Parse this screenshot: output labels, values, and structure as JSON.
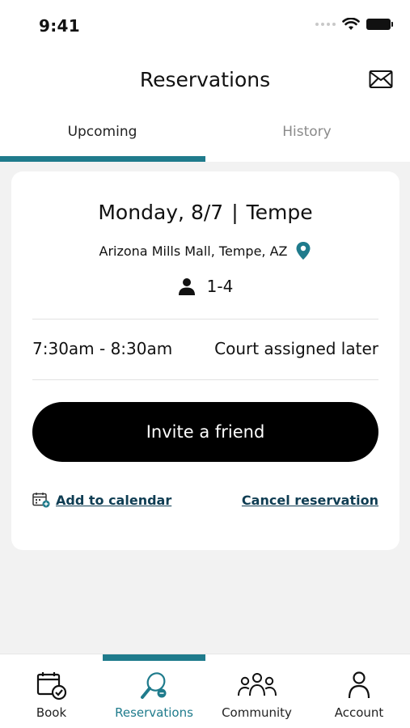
{
  "status_bar": {
    "time": "9:41"
  },
  "header": {
    "title": "Reservations"
  },
  "tabs": [
    {
      "label": "Upcoming",
      "active": true
    },
    {
      "label": "History",
      "active": false
    }
  ],
  "reservation": {
    "date": "Monday, 8/7",
    "separator": "|",
    "city": "Tempe",
    "address": "Arizona Mills Mall, Tempe, AZ",
    "players": "1-4",
    "time": "7:30am - 8:30am",
    "court": "Court assigned later",
    "invite_label": "Invite a friend",
    "add_calendar_label": "Add to calendar",
    "cancel_label": "Cancel reservation"
  },
  "bottom_nav": [
    {
      "label": "Book",
      "icon": "calendar-check-icon",
      "active": false
    },
    {
      "label": "Reservations",
      "icon": "paddle-icon",
      "active": true
    },
    {
      "label": "Community",
      "icon": "group-icon",
      "active": false
    },
    {
      "label": "Account",
      "icon": "person-icon",
      "active": false
    }
  ],
  "colors": {
    "accent": "#1f7b8c",
    "link": "#0f3d53",
    "background": "#f2f2f2"
  }
}
